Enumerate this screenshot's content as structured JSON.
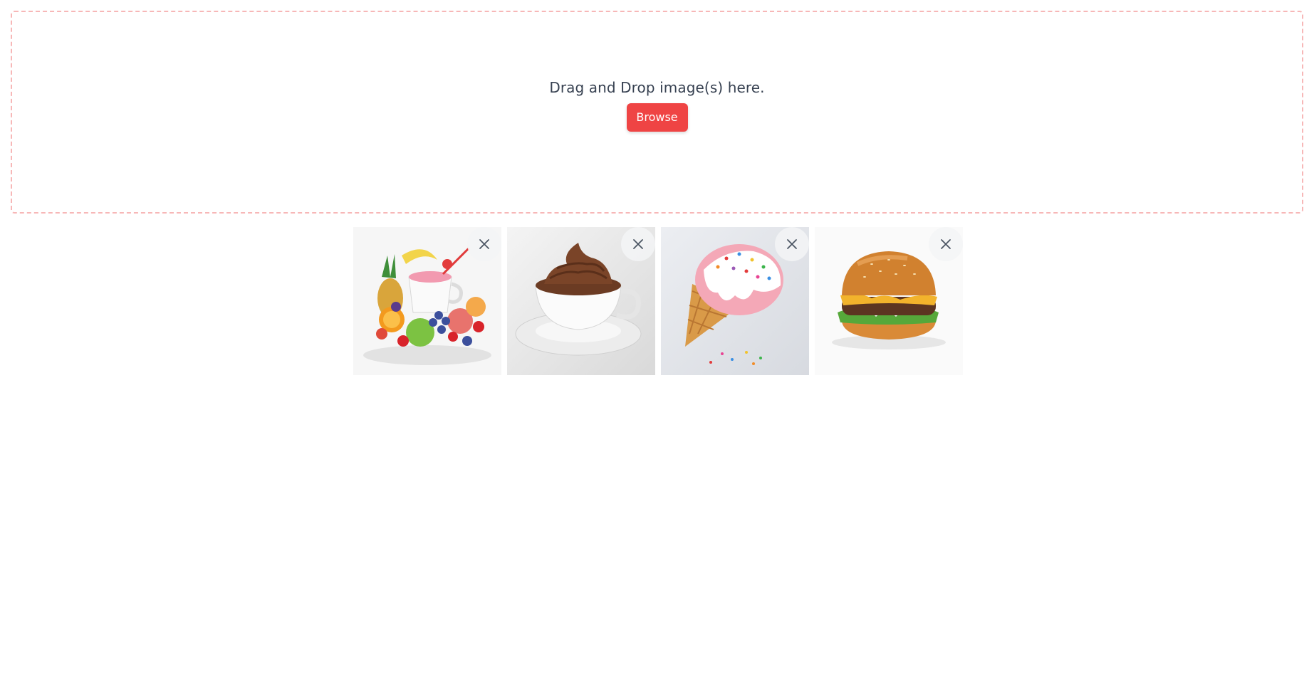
{
  "dropzone": {
    "instruction": "Drag and Drop image(s) here.",
    "browse_label": "Browse",
    "accent_color": "#ef4444",
    "border_color": "#f7b7b7"
  },
  "gallery": {
    "images": [
      {
        "subject": "fruit bowl with smoothie cup",
        "remove_icon": "close-icon"
      },
      {
        "subject": "chocolate mousse in cup",
        "remove_icon": "close-icon"
      },
      {
        "subject": "strawberry ice cream cone with sprinkles",
        "remove_icon": "close-icon"
      },
      {
        "subject": "cheeseburger",
        "remove_icon": "close-icon"
      }
    ]
  }
}
